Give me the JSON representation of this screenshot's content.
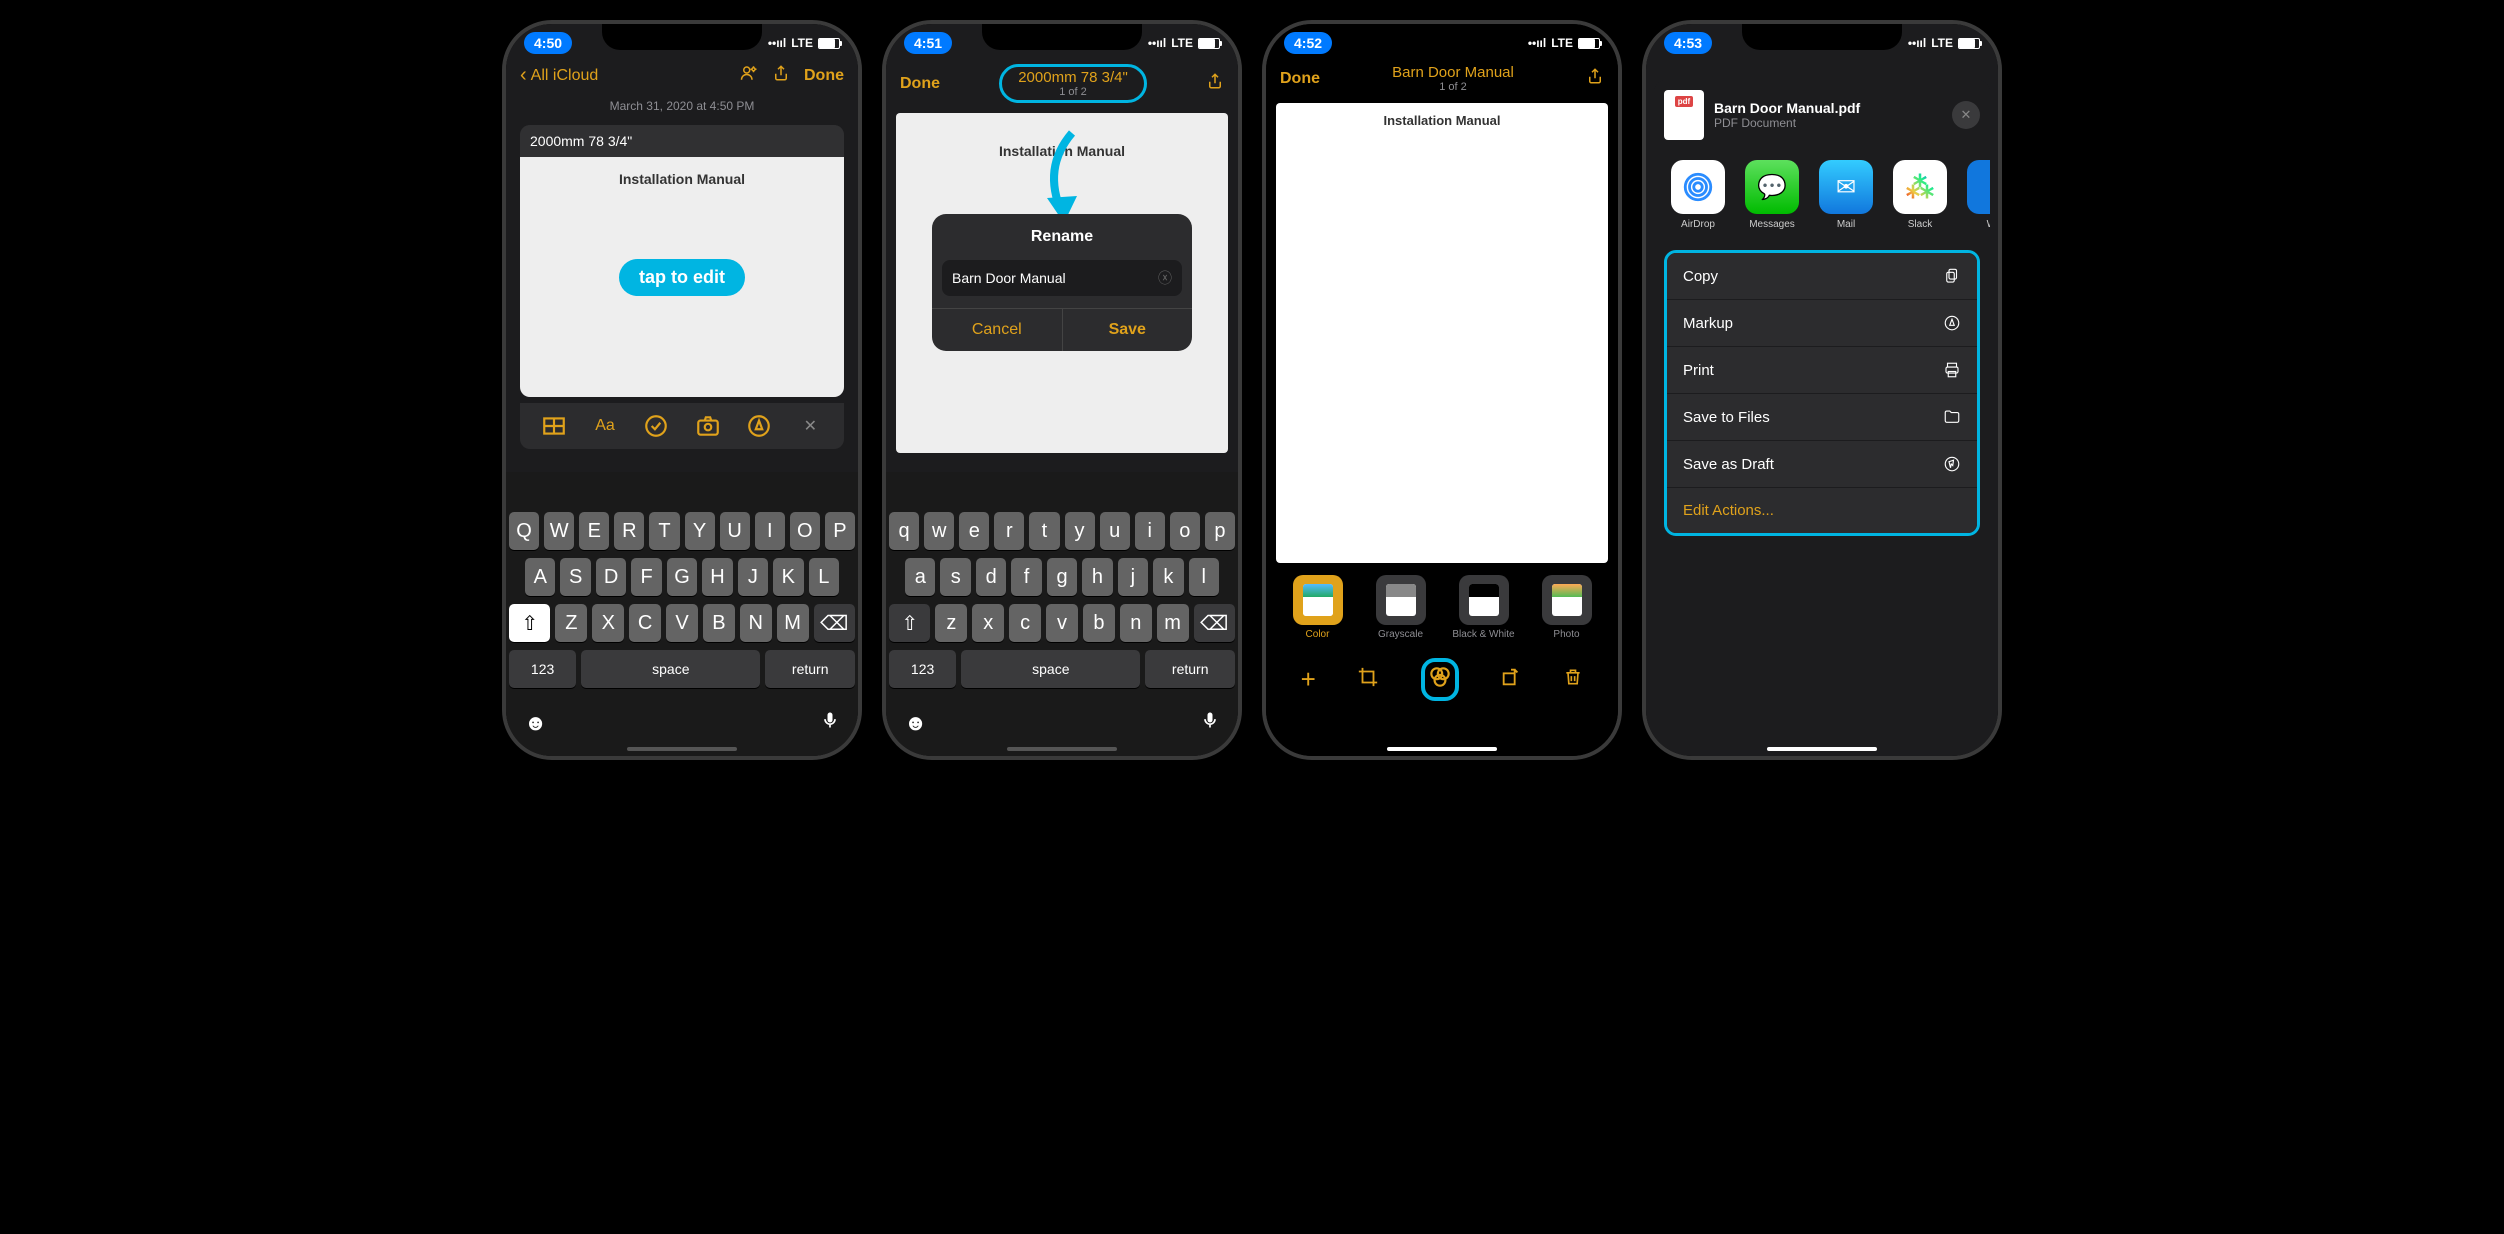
{
  "phone1": {
    "time": "4:50",
    "back": "All iCloud",
    "done": "Done",
    "timestamp": "March 31, 2020 at 4:50 PM",
    "doc_title": "2000mm 78 3/4\"",
    "doc_heading": "Installation Manual",
    "tap_edit": "tap to edit"
  },
  "phone2": {
    "time": "4:51",
    "done": "Done",
    "title": "2000mm 78 3/4\"",
    "pagecount": "1 of 2",
    "doc_heading": "Installation Manual",
    "dialog_title": "Rename",
    "input_value": "Barn Door Manual",
    "cancel": "Cancel",
    "save": "Save"
  },
  "phone3": {
    "time": "4:52",
    "done": "Done",
    "title": "Barn Door Manual",
    "pagecount": "1 of 2",
    "doc_heading": "Installation Manual",
    "filters": [
      "Color",
      "Grayscale",
      "Black & White",
      "Photo"
    ]
  },
  "phone4": {
    "time": "4:53",
    "title": "Barn Door Manual",
    "file_name": "Barn Door Manual.pdf",
    "file_type": "PDF Document",
    "apps": [
      "AirDrop",
      "Messages",
      "Mail",
      "Slack",
      "Wo"
    ],
    "actions": [
      "Copy",
      "Markup",
      "Print",
      "Save to Files",
      "Save as Draft"
    ],
    "edit_actions": "Edit Actions..."
  },
  "kb": {
    "row1": [
      "Q",
      "W",
      "E",
      "R",
      "T",
      "Y",
      "U",
      "I",
      "O",
      "P"
    ],
    "row1l": [
      "q",
      "w",
      "e",
      "r",
      "t",
      "y",
      "u",
      "i",
      "o",
      "p"
    ],
    "row2": [
      "A",
      "S",
      "D",
      "F",
      "G",
      "H",
      "J",
      "K",
      "L"
    ],
    "row2l": [
      "a",
      "s",
      "d",
      "f",
      "g",
      "h",
      "j",
      "k",
      "l"
    ],
    "row3": [
      "Z",
      "X",
      "C",
      "V",
      "B",
      "N",
      "M"
    ],
    "row3l": [
      "z",
      "x",
      "c",
      "v",
      "b",
      "n",
      "m"
    ],
    "num": "123",
    "space": "space",
    "ret": "return"
  },
  "lte": "LTE"
}
